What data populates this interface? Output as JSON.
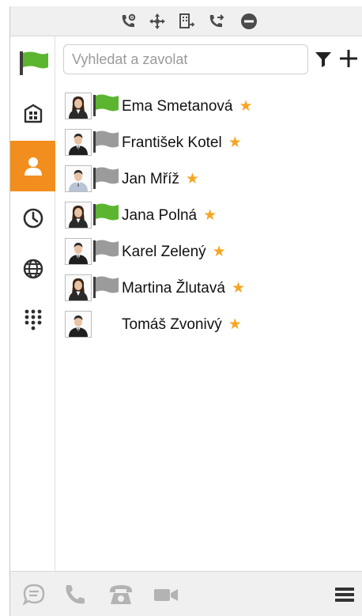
{
  "search": {
    "placeholder": "Vyhledat a zavolat"
  },
  "contacts": [
    {
      "name": "Ema Smetanová",
      "status": "available",
      "gender": "f",
      "favorite": true
    },
    {
      "name": "František Kotel",
      "status": "offline",
      "gender": "m",
      "favorite": true
    },
    {
      "name": "Jan Mříž",
      "status": "offline",
      "gender": "m2",
      "favorite": true
    },
    {
      "name": "Jana Polná",
      "status": "available",
      "gender": "f",
      "favorite": true
    },
    {
      "name": "Karel Zelený",
      "status": "offline",
      "gender": "m",
      "favorite": true
    },
    {
      "name": "Martina Žlutavá",
      "status": "offline",
      "gender": "f2",
      "favorite": true
    },
    {
      "name": "Tomáš Zvonivý",
      "status": "none",
      "gender": "m",
      "favorite": true
    }
  ],
  "favorite_star": "★",
  "colors": {
    "accent": "#f28e1d",
    "status_available": "#5cb531",
    "status_offline": "#9b9b9b",
    "star": "#f5a623",
    "toolbar_icon": "#4b4b4b",
    "bottom_icon": "#b3b3b3"
  },
  "icons": {
    "toolbar": [
      "call-settings-icon",
      "call-routing-icon",
      "queue-icon",
      "call-forward-icon",
      "do-not-disturb-icon"
    ],
    "nav": [
      "status-flag-icon",
      "company-icon",
      "contacts-icon",
      "history-icon",
      "globe-icon",
      "dialpad-icon"
    ],
    "bottom": [
      "chat-icon",
      "phone-icon",
      "desk-phone-icon",
      "video-icon",
      "menu-icon"
    ]
  }
}
